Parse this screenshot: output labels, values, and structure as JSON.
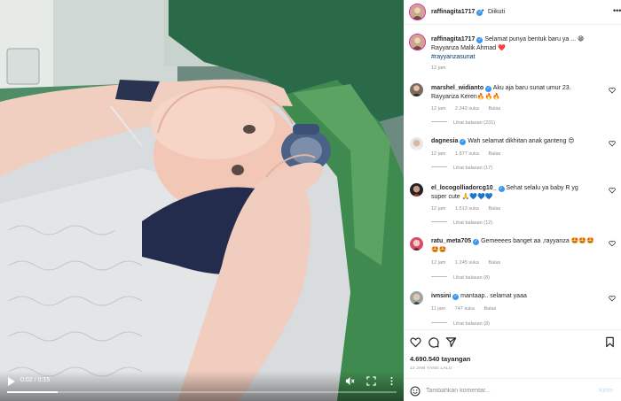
{
  "video": {
    "current_time": "0:02",
    "duration": "0:15",
    "time_separator": "/",
    "progress": 0.13
  },
  "post": {
    "author": "raffinagita1717",
    "follow_separator": "•",
    "follow_status": "Diikuti",
    "caption_line1": "Selamat punya bentuk baru ya ... 😁",
    "caption_line2": "Rayyanza Malik Ahmad ❤️",
    "hashtag": "#rayyanzasunat",
    "caption_time": "12 jam",
    "views": "4.690.540 tayangan",
    "time_ago": "12 JAM YANG LALU"
  },
  "comments": [
    {
      "user": "marshel_widianto",
      "text": "Aku aja baru sunat umur 23. Rayyanza Keren🔥🔥🔥",
      "time": "12 jam",
      "likes": "2.343 suka",
      "reply": "Balas",
      "replies": "Lihat balasan (231)",
      "verified": true
    },
    {
      "user": "dagnesia",
      "text": "Wah selamat dikhitan anak ganteng 😍",
      "time": "12 jam",
      "likes": "1.877 suka",
      "reply": "Balas",
      "replies": "Lihat balasan (17)",
      "verified": true
    },
    {
      "user": "el_locogolliadorcg10_",
      "text": "Sehat selalu ya baby R yg super cute 🙏💙💙💙",
      "time": "12 jam",
      "likes": "1.513 suka",
      "reply": "Balas",
      "replies": "Lihat balasan (12)",
      "verified": true
    },
    {
      "user": "ratu_meta705",
      "text": "Gemeeees banget aa ,rayyanza 🤩🤩🤩🤩🤩",
      "time": "12 jam",
      "likes": "1.245 suka",
      "reply": "Balas",
      "replies": "Lihat balasan (8)",
      "verified": true
    },
    {
      "user": "ivnsini",
      "text": "mantaap.. selamat yaaa",
      "time": "11 jam",
      "likes": "747 suka",
      "reply": "Balas",
      "replies": "Lihat balasan (8)",
      "verified": true
    }
  ],
  "composer": {
    "placeholder": "Tambahkan komentar...",
    "post_label": "Kirim"
  },
  "colors": {
    "surgical_green": "#3f8a4f",
    "link_blue": "#00376b",
    "verified_blue": "#3897f0",
    "muted_text": "#8e8e8e"
  },
  "icons": [
    "play-icon",
    "mute-icon",
    "fullscreen-icon",
    "more-icon",
    "heart-icon",
    "comment-icon",
    "share-icon",
    "bookmark-icon",
    "emoji-icon"
  ]
}
